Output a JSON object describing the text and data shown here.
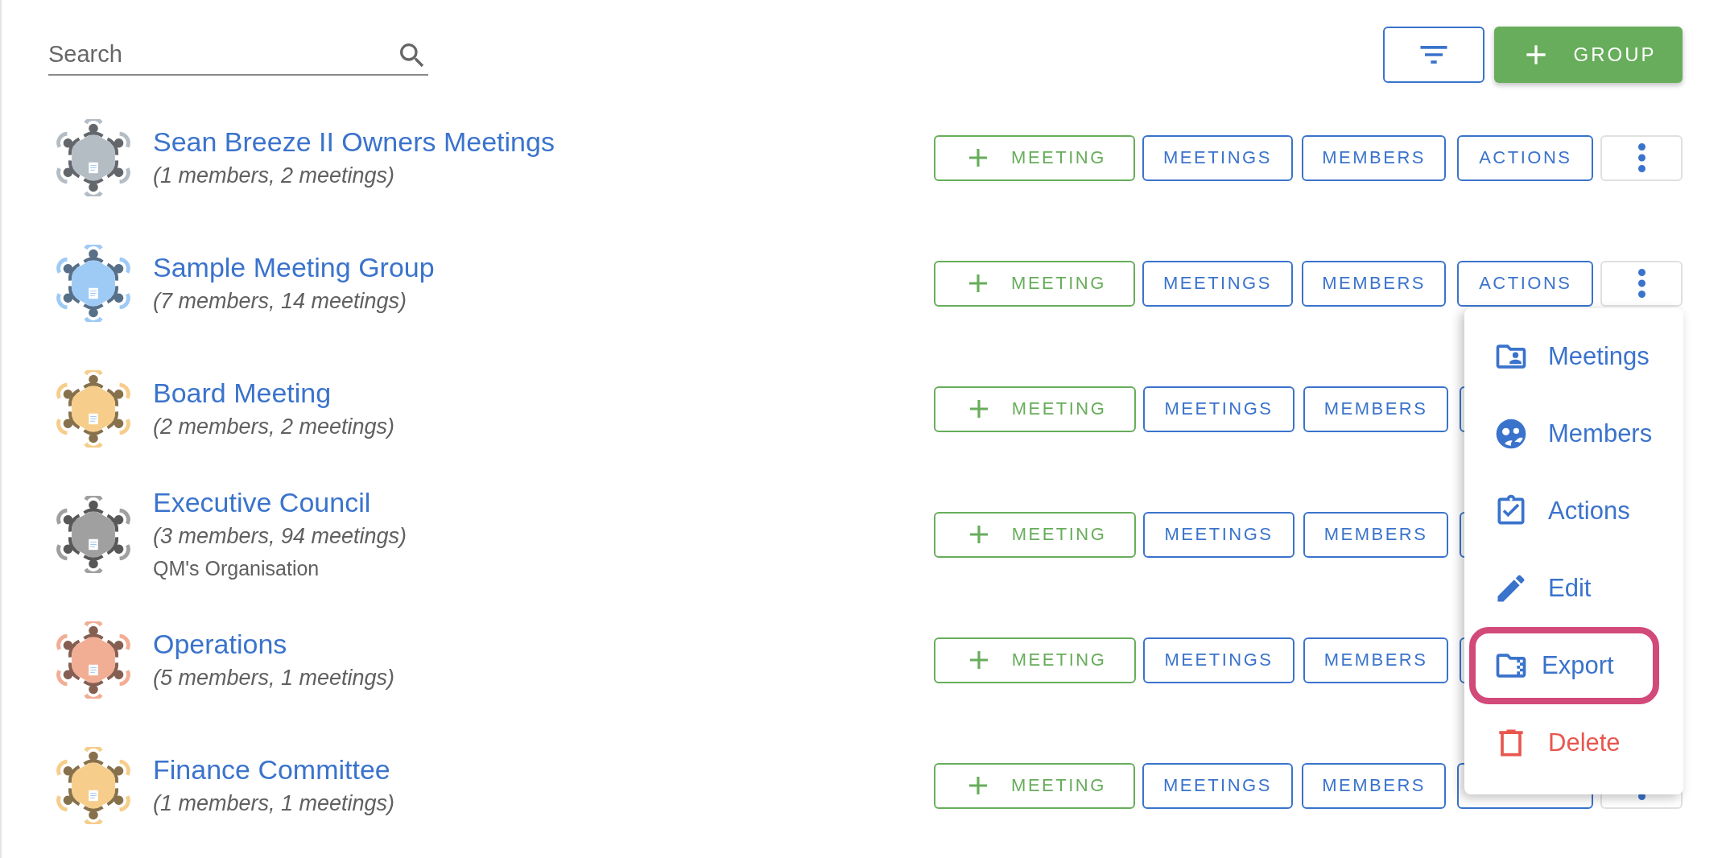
{
  "search": {
    "placeholder": "Search"
  },
  "toolbar": {
    "add_group_label": "GROUP"
  },
  "groups": [
    {
      "title": "Sean Breeze II Owners Meetings",
      "summary": "(1 members, 2 meetings)",
      "color": "#b4bcc4",
      "buttons": [
        {
          "kind": "add",
          "label": "MEETING"
        },
        {
          "kind": "outline",
          "label": "MEETINGS"
        },
        {
          "kind": "outline",
          "label": "MEMBERS"
        },
        {
          "kind": "outline",
          "label": "ACTIONS"
        },
        {
          "kind": "more"
        }
      ]
    },
    {
      "title": "Sample Meeting Group",
      "summary": "(7 members, 14 meetings)",
      "color": "#9ecaf6",
      "buttons": [
        {
          "kind": "add",
          "label": "MEETING"
        },
        {
          "kind": "outline",
          "label": "MEETINGS"
        },
        {
          "kind": "outline",
          "label": "MEMBERS"
        },
        {
          "kind": "outline",
          "label": "ACTIONS"
        },
        {
          "kind": "more"
        }
      ]
    },
    {
      "title": "Board Meeting",
      "summary": "(2 members, 2 meetings)",
      "color": "#f6cd8a",
      "buttons": [
        {
          "kind": "add",
          "label": "MEETING"
        },
        {
          "kind": "outline",
          "label": "MEETINGS"
        },
        {
          "kind": "outline",
          "label": "MEMBERS"
        },
        {
          "kind": "outline"
        }
      ]
    },
    {
      "title": "Executive Council",
      "summary": "(3 members, 94 meetings)",
      "organisation": "QM's Organisation",
      "color": "#a0a0a0",
      "buttons": [
        {
          "kind": "add",
          "label": "MEETING"
        },
        {
          "kind": "outline",
          "label": "MEETINGS"
        },
        {
          "kind": "outline",
          "label": "MEMBERS"
        },
        {
          "kind": "outline"
        }
      ]
    },
    {
      "title": "Operations",
      "summary": "(5 members, 1 meetings)",
      "color": "#f2ad95",
      "buttons": [
        {
          "kind": "add",
          "label": "MEETING"
        },
        {
          "kind": "outline",
          "label": "MEETINGS"
        },
        {
          "kind": "outline",
          "label": "MEMBERS"
        },
        {
          "kind": "outline"
        }
      ]
    },
    {
      "title": "Finance Committee",
      "summary": "(1 members, 1 meetings)",
      "color": "#f6cd8a",
      "buttons": [
        {
          "kind": "add",
          "label": "MEETING"
        },
        {
          "kind": "outline",
          "label": "MEETINGS"
        },
        {
          "kind": "outline",
          "label": "MEMBERS"
        },
        {
          "kind": "outline"
        },
        {
          "kind": "more"
        }
      ]
    }
  ],
  "menu": {
    "items": [
      {
        "label": "Meetings",
        "kind": "normal",
        "highlighted": false
      },
      {
        "label": "Members",
        "kind": "normal",
        "highlighted": false
      },
      {
        "label": "Actions",
        "kind": "normal",
        "highlighted": false
      },
      {
        "label": "Edit",
        "kind": "normal",
        "highlighted": false
      },
      {
        "label": "Export",
        "kind": "normal",
        "highlighted": true
      },
      {
        "label": "Delete",
        "kind": "danger",
        "highlighted": false
      }
    ]
  }
}
